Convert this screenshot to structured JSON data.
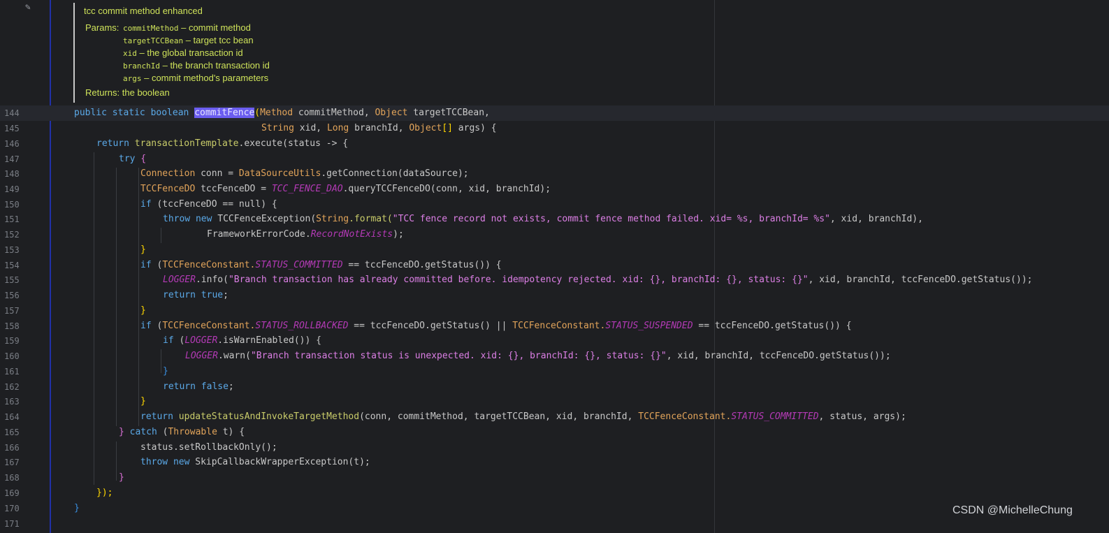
{
  "doc": {
    "title": "tcc commit method enhanced",
    "params_label": "Params:",
    "params": [
      {
        "name": "commitMethod",
        "desc": " – commit method"
      },
      {
        "name": "targetTCCBean",
        "desc": " – target tcc bean"
      },
      {
        "name": "xid",
        "desc": " – the global transaction id"
      },
      {
        "name": "branchId",
        "desc": " – the branch transaction id"
      },
      {
        "name": "args",
        "desc": " – commit method's parameters"
      }
    ],
    "returns_label": "Returns:",
    "returns_desc": "the boolean"
  },
  "line_numbers": [
    "144",
    "145",
    "146",
    "147",
    "148",
    "149",
    "150",
    "151",
    "152",
    "153",
    "154",
    "155",
    "156",
    "157",
    "158",
    "159",
    "160",
    "161",
    "162",
    "163",
    "164",
    "165",
    "166",
    "167",
    "168",
    "169",
    "170",
    "171"
  ],
  "code": {
    "l144": {
      "kw1": "public static boolean ",
      "fn": "commitFence",
      "p1": "(",
      "t1": "Method",
      "v1": " commitMethod, ",
      "t2": "Object",
      "v2": " targetTCCBean,"
    },
    "l145": {
      "t1": "String",
      "v1": " xid, ",
      "t2": "Long",
      "v2": " branchId, ",
      "t3": "Object",
      "b": "[]",
      "v3": " args) {"
    },
    "l146": {
      "kw": "return ",
      "fn": "transactionTemplate",
      "m": ".execute(status -> {"
    },
    "l147": {
      "kw": "try",
      "rest": " {"
    },
    "l148": {
      "t": "Connection",
      "v": " conn = ",
      "t2": "DataSourceUtils",
      "m": ".getConnection(dataSource);"
    },
    "l149": {
      "t": "TCCFenceDO",
      "v": " tccFenceDO = ",
      "c": "TCC_FENCE_DAO",
      "m": ".queryTCCFenceDO(conn, xid, branchId);"
    },
    "l150": {
      "kw": "if",
      "rest": " (tccFenceDO == null) {"
    },
    "l151": {
      "kw": "throw new ",
      "fn": "TCCFenceException(",
      "t": "String",
      "m": ".format(",
      "s": "\"TCC fence record not exists, commit fence method failed. xid= %s, branchId= %s\"",
      "rest": ", xid, branchId),"
    },
    "l152": {
      "fn": "FrameworkErrorCode.",
      "c": "RecordNotExists",
      "rest": ");"
    },
    "l153": {
      "rest": "}"
    },
    "l154": {
      "kw": "if",
      "p": " (",
      "t": "TCCFenceConstant.",
      "c": "STATUS_COMMITTED",
      "rest": " == tccFenceDO.getStatus()) {"
    },
    "l155": {
      "c": "LOGGER",
      "m": ".info(",
      "s": "\"Branch transaction has already committed before. idempotency rejected. xid: {}, branchId: {}, status: {}\"",
      "rest": ", xid, branchId, tccFenceDO.getStatus());"
    },
    "l156": {
      "kw": "return true",
      "rest": ";"
    },
    "l157": {
      "rest": "}"
    },
    "l158": {
      "kw": "if",
      "p": " (",
      "t": "TCCFenceConstant.",
      "c": "STATUS_ROLLBACKED",
      "m": " == tccFenceDO.getStatus() || ",
      "t2": "TCCFenceConstant.",
      "c2": "STATUS_SUSPENDED",
      "rest": " == tccFenceDO.getStatus()) {"
    },
    "l159": {
      "kw": "if",
      "p": " (",
      "c": "LOGGER",
      "rest": ".isWarnEnabled()) {"
    },
    "l160": {
      "c": "LOGGER",
      "m": ".warn(",
      "s": "\"Branch transaction status is unexpected. xid: {}, branchId: {}, status: {}\"",
      "rest": ", xid, branchId, tccFenceDO.getStatus());"
    },
    "l161": {
      "rest": "}"
    },
    "l162": {
      "kw": "return false",
      "rest": ";"
    },
    "l163": {
      "rest": "}"
    },
    "l164": {
      "kw": "return ",
      "fn": "updateStatusAndInvokeTargetMethod",
      "m": "(conn, commitMethod, targetTCCBean, xid, branchId, ",
      "t": "TCCFenceConstant.",
      "c": "STATUS_COMMITTED",
      "rest": ", status, args);"
    },
    "l165": {
      "p": "} ",
      "kw": "catch",
      "m": " (",
      "t": "Throwable",
      "rest": " t) {"
    },
    "l166": {
      "m": "status.setRollbackOnly();"
    },
    "l167": {
      "kw": "throw new ",
      "rest": "SkipCallbackWrapperException(t);"
    },
    "l168": {
      "rest": "}"
    },
    "l169": {
      "rest": "});"
    },
    "l170": {
      "rest": "}"
    }
  },
  "watermark": "CSDN @MichelleChung"
}
